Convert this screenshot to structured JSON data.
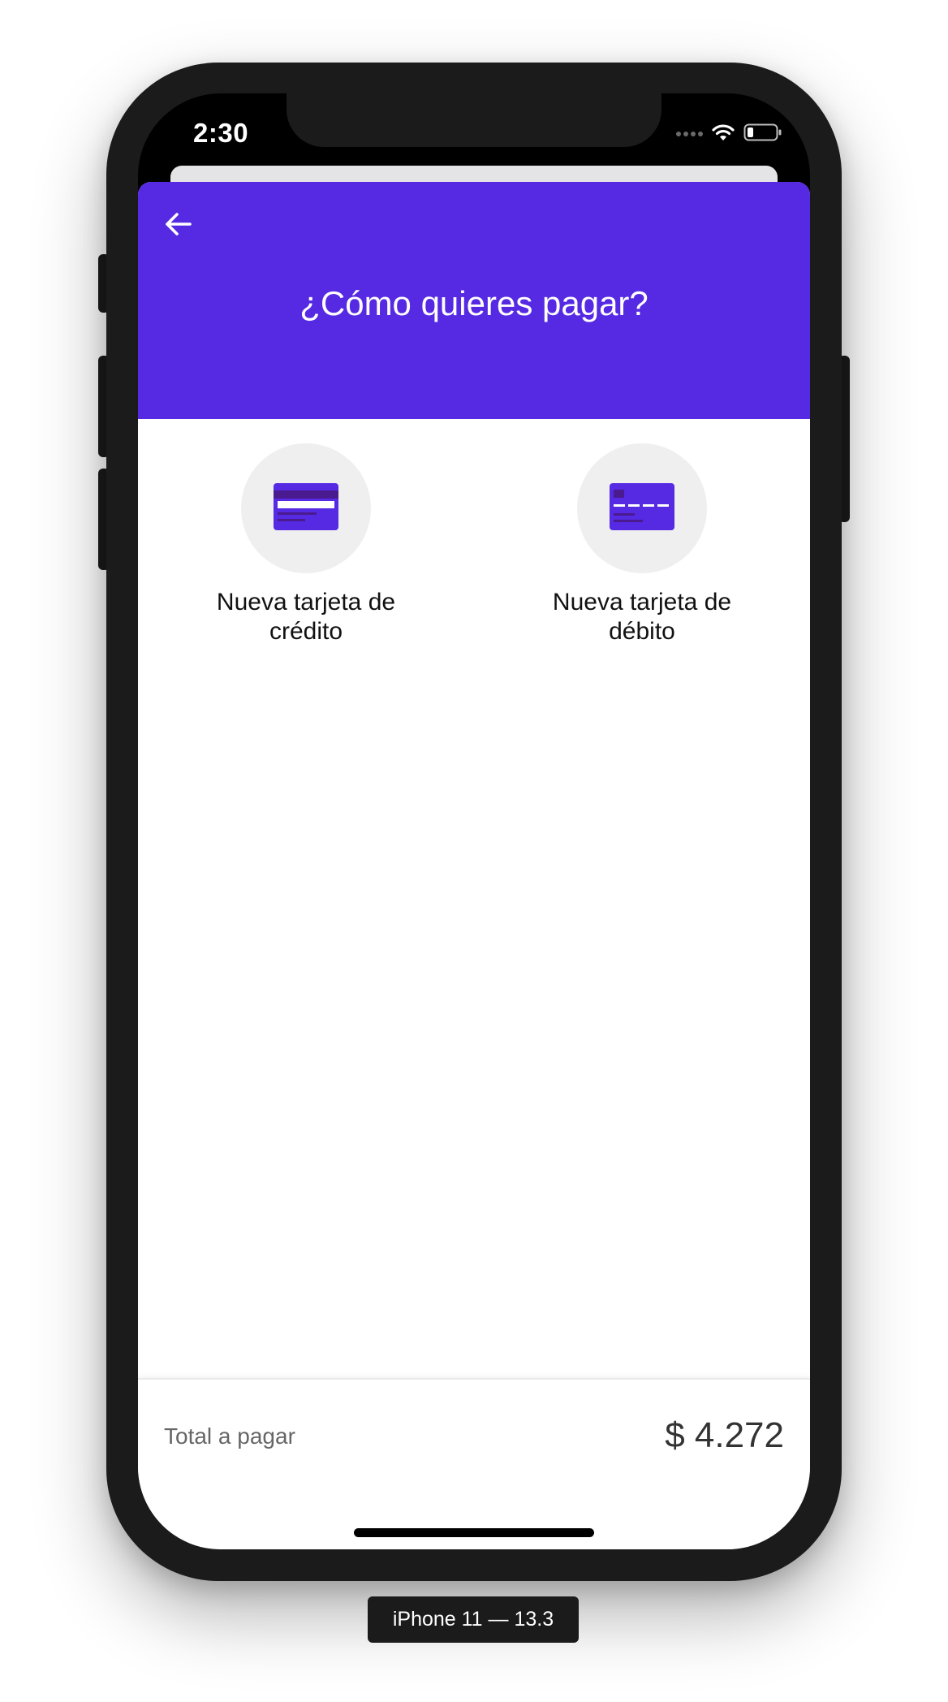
{
  "status_bar": {
    "time": "2:30",
    "wifi_icon": "wifi-icon",
    "battery_icon": "battery-icon"
  },
  "header": {
    "back_icon": "arrow-left-icon",
    "title": "¿Cómo quieres pagar?"
  },
  "payment_options": [
    {
      "label": "Nueva tarjeta de crédito",
      "icon": "credit-card-icon"
    },
    {
      "label": "Nueva tarjeta de débito",
      "icon": "debit-card-icon"
    }
  ],
  "footer": {
    "total_label": "Total a pagar",
    "total_amount": "$ 4.272"
  },
  "device_label": "iPhone 11 — 13.3",
  "colors": {
    "header_background": "#5629e3",
    "card_primary": "#5629e3",
    "card_stripe": "#4a1a8f",
    "option_circle": "#efefef"
  }
}
